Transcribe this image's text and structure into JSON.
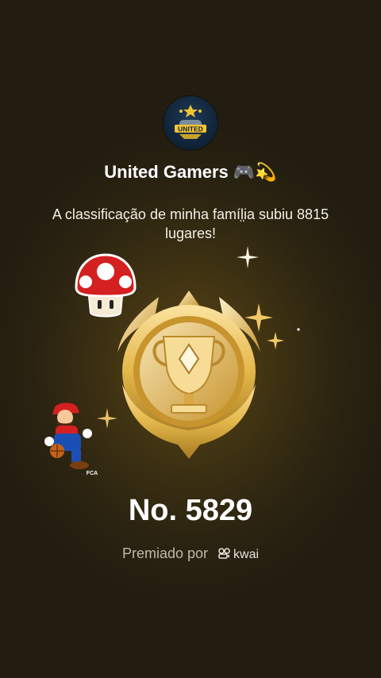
{
  "group": {
    "avatar_icon": "united-gamers-logo",
    "avatar_text": "UNITED",
    "name": "United Gamers 🎮💫"
  },
  "message": "A classificação de minha famíl̤ia subiu 8815 lugares!",
  "rank": "No. 5829",
  "award": {
    "label": "Premiado por",
    "brand": "kwai"
  },
  "colors": {
    "gold": "#e4b74a",
    "mushroom_red": "#d42020"
  }
}
